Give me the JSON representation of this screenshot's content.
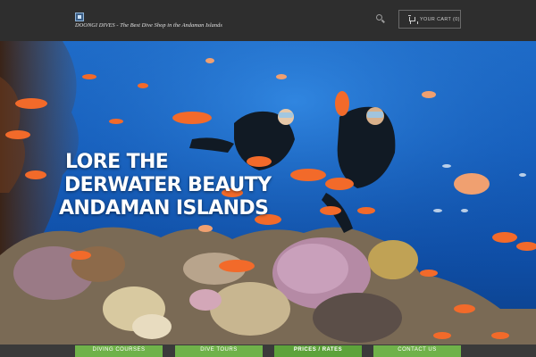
{
  "header": {
    "tagline": "DOONGI DIVES - The Best Dive Shop in the Andaman Islands",
    "cart_label": "YOUR CART (0)",
    "icons": {
      "logo": "logo-icon",
      "search": "search-icon",
      "cart": "cart-icon"
    }
  },
  "hero": {
    "line1": "LORE THE",
    "line2": "DERWATER BEAUTY",
    "line3": "ANDAMAN ISLANDS"
  },
  "nav": {
    "items": [
      {
        "label": "DIVING COURSES"
      },
      {
        "label": "DIVE TOURS"
      },
      {
        "label": "PRICES / RATES"
      },
      {
        "label": "CONTACT US"
      }
    ]
  },
  "colors": {
    "header": "#2e2e2e",
    "nav_green": "#6fb24a",
    "ocean": "#1661c2",
    "fish": "#f26a2a"
  }
}
